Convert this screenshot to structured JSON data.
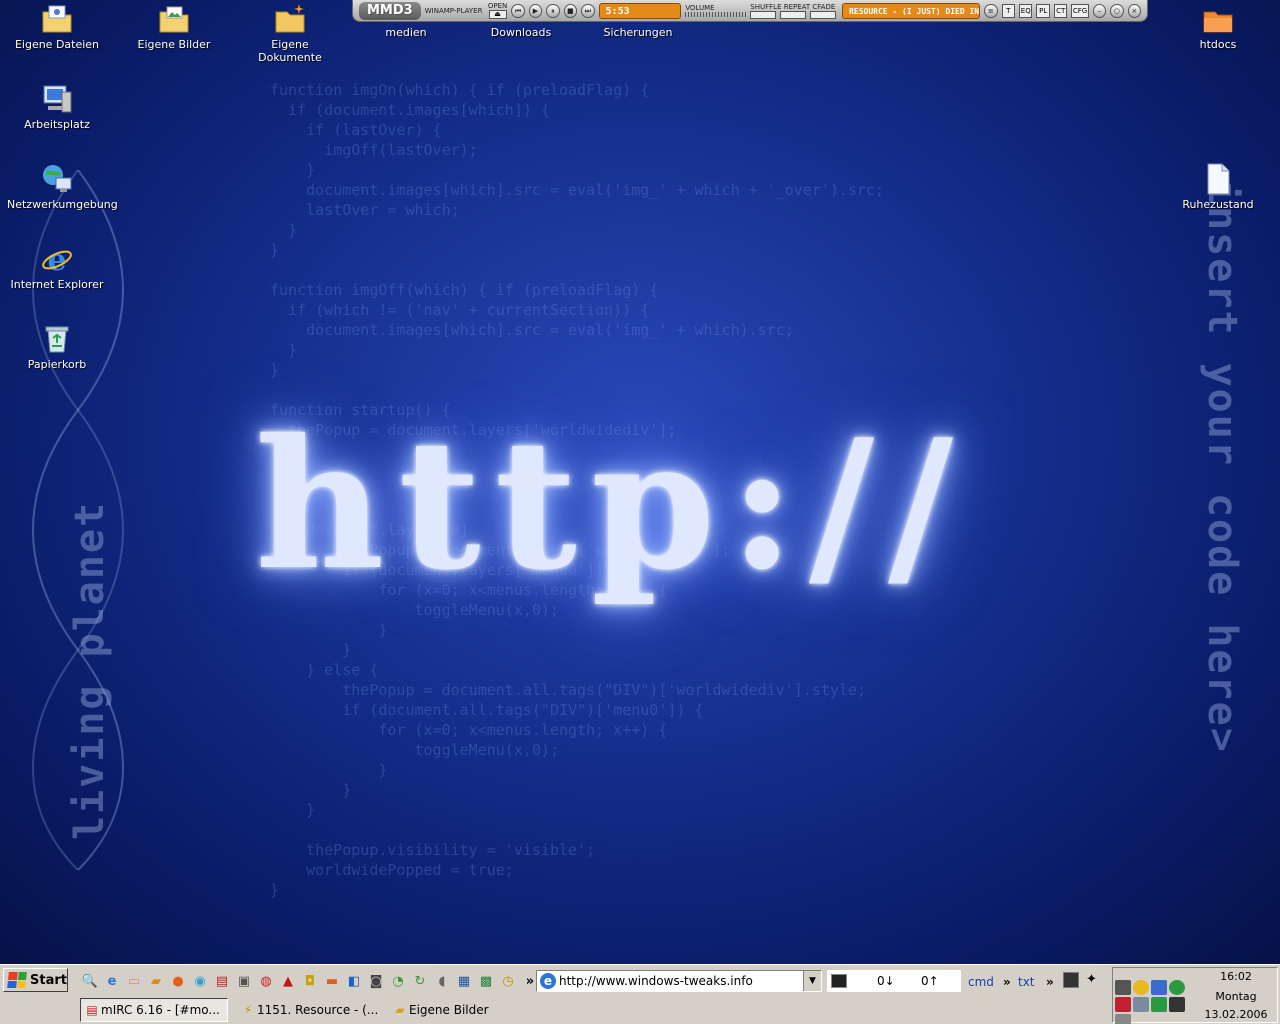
{
  "desktop": {
    "icons_left": [
      {
        "label": "Eigene Dateien",
        "icon": "folder-documents-icon"
      },
      {
        "label": "Arbeitsplatz",
        "icon": "my-computer-icon"
      },
      {
        "label": "Netzwerkumgebung",
        "icon": "network-icon"
      },
      {
        "label": "Internet Explorer",
        "icon": "ie-icon"
      },
      {
        "label": "Papierkorb",
        "icon": "recycle-bin-icon"
      }
    ],
    "icons_top": [
      {
        "label": "Eigene Bilder",
        "icon": "folder-pictures-icon"
      },
      {
        "label": "Eigene Dokumente",
        "icon": "folder-icon"
      },
      {
        "label": "medien",
        "icon": "folder-icon"
      },
      {
        "label": "Downloads",
        "icon": "folder-icon"
      },
      {
        "label": "Sicherungen",
        "icon": "folder-icon"
      }
    ],
    "icons_right": [
      {
        "label": "htdocs",
        "icon": "folder-orange-icon"
      },
      {
        "label": "Ruhezustand",
        "icon": "file-icon"
      }
    ],
    "wallpaper": {
      "headline": "http://",
      "left_text": "living planet",
      "right_text": "insert your code here>",
      "code": "function imgOn(which) { if (preloadFlag) {\n  if (document.images[which]) {\n    if (lastOver) {\n      imgOff(lastOver);\n    }\n    document.images[which].src = eval('img_' + which + '_over').src;\n    lastOver = which;\n  }\n}\n\nfunction imgOff(which) { if (preloadFlag) {\n  if (which != ('nav' + currentSection)) {\n    document.images[which].src = eval('img_' + which).src;\n  }\n}\n\nfunction startup() {\n  thePopup = document.layers['worldwidediv'];\n\n\n\n\n    document.layers[0]\n        thePopup = document.layers['worldwidediv'];\n        if (document.layers['menu0']) {\n            for (x=0; x<menus.length; x++) {\n                toggleMenu(x,0);\n            }\n        }\n    } else {\n        thePopup = document.all.tags(\"DIV\")['worldwidediv'].style;\n        if (document.all.tags(\"DIV\")['menu0']) {\n            for (x=0; x<menus.length; x++) {\n                toggleMenu(x,0);\n            }\n        }\n    }\n\n    thePopup.visibility = 'visible';\n    worldwidePopped = true;\n}"
    }
  },
  "player": {
    "logo": "MMD3",
    "sub": "WINAMP-PLAYER",
    "open": "OPEN",
    "time": "5:53",
    "volume": "VOLUME",
    "shuffle_repeat": "SHUFFLE  REPEAT  CFADE",
    "track": "RESOURCE - (I JUST) DIED IN YOUR",
    "buttons": [
      "T",
      "EQ",
      "PL",
      "CT",
      "CFG"
    ]
  },
  "taskbar": {
    "start": "Start",
    "address": "http://www.windows-tweaks.info",
    "net_down": "0↓",
    "net_up": "0↑",
    "cmd": "cmd",
    "txt": "txt",
    "tasks": [
      {
        "label": "mIRC 6.16 - [#mo...",
        "active": true
      },
      {
        "label": "1151. Resource - (...",
        "active": false
      },
      {
        "label": "Eigene Bilder",
        "active": false
      }
    ],
    "clock": {
      "time": "16:02",
      "day": "Montag",
      "date": "13.02.2006"
    }
  },
  "colors": {
    "accent": "#e48a18",
    "desktop": "#15308f",
    "taskbar": "#d4d0c8"
  }
}
